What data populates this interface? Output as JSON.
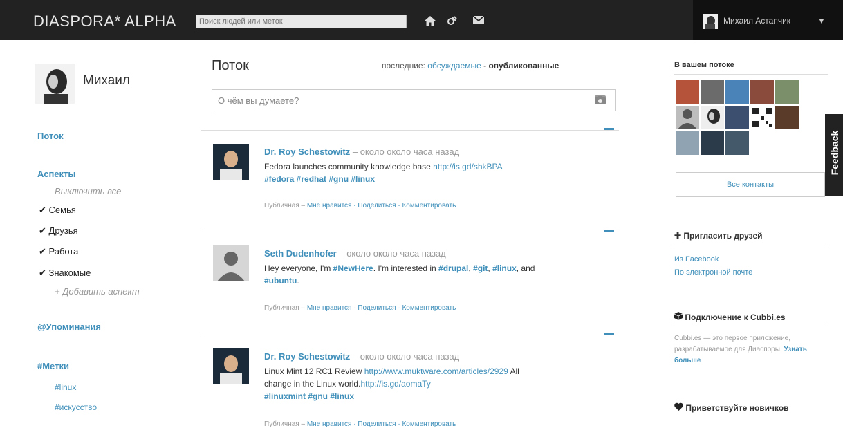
{
  "header": {
    "logo": "DIASPORA* ALPHA",
    "search_placeholder": "Поиск людей или меток",
    "user_name": "Михаил Астапчик",
    "user_caret": "▼"
  },
  "sidebar": {
    "profile_name": "Михаил",
    "stream": "Поток",
    "aspects_title": "Аспекты",
    "toggle_all": "Выключить все",
    "aspects": [
      "Семья",
      "Друзья",
      "Работа",
      "Знакомые"
    ],
    "add_aspect": "+ Добавить аспект",
    "mentions": "@Упоминания",
    "tags_title": "#Метки",
    "tags": [
      "#linux",
      "#искусство"
    ]
  },
  "stream": {
    "title": "Поток",
    "sort_prefix": "последние:",
    "sort_discussed": "обсуждаемые",
    "sort_sep": " - ",
    "sort_published": "опубликованные",
    "composer_placeholder": "О чём вы думаете?",
    "posts": [
      {
        "author": "Dr. Roy Schestowitz",
        "time": " – около около часа назад",
        "line1_text": "Fedora launches community knowledge base ",
        "line1_link": "http://is.gd/shkBPA",
        "line2_tags": "#fedora #redhat #gnu #linux",
        "meta_public": "Публичная – ",
        "meta_actions": "Мне нравится · Поделиться · Комментировать"
      },
      {
        "author": "Seth Dudenhofer",
        "time": " – около около часа назад",
        "line1_a": "Hey everyone, I'm ",
        "line1_tag1": "#NewHere",
        "line1_b": ". I'm interested in ",
        "line1_tag2": "#drupal",
        "line1_c": ", ",
        "line1_tag3": "#git",
        "line1_d": ", ",
        "line1_tag4": "#linux",
        "line1_e": ", and",
        "line2_tag": "#ubuntu",
        "line2_end": ".",
        "meta_public": "Публичная – ",
        "meta_actions": "Мне нравится · Поделиться · Комментировать"
      },
      {
        "author": "Dr. Roy Schestowitz",
        "time": " – около около часа назад",
        "line1_text": "Linux Mint 12 RC1 Review ",
        "line1_link": "http://www.muktware.com/articles/2929",
        "line1_end": " All",
        "line2_text": "change in the Linux world.",
        "line2_link": "http://is.gd/aomaTy",
        "line3_tags": "#linuxmint #gnu #linux",
        "meta_public": "Публичная – ",
        "meta_actions": "Мне нравится · Поделиться · Комментировать"
      }
    ]
  },
  "right": {
    "in_stream_title": "В вашем потоке",
    "all_contacts": "Все контакты",
    "invite_title": "Пригласить друзей",
    "invite_plus": "✚",
    "invite_facebook": "Из Facebook",
    "invite_email": "По электронной почте",
    "cubbies_title": "Подключение к Cubbi.es",
    "cubbies_text": "Cubbi.es — это первое приложение, разрабатываемое для Диаспоры.",
    "cubbies_more": "Узнать больше",
    "welcome_title": "Приветствуйте новичков",
    "feedback": "Feedback"
  },
  "colors": {
    "topbar": "#222222",
    "link": "#3f8fba"
  }
}
